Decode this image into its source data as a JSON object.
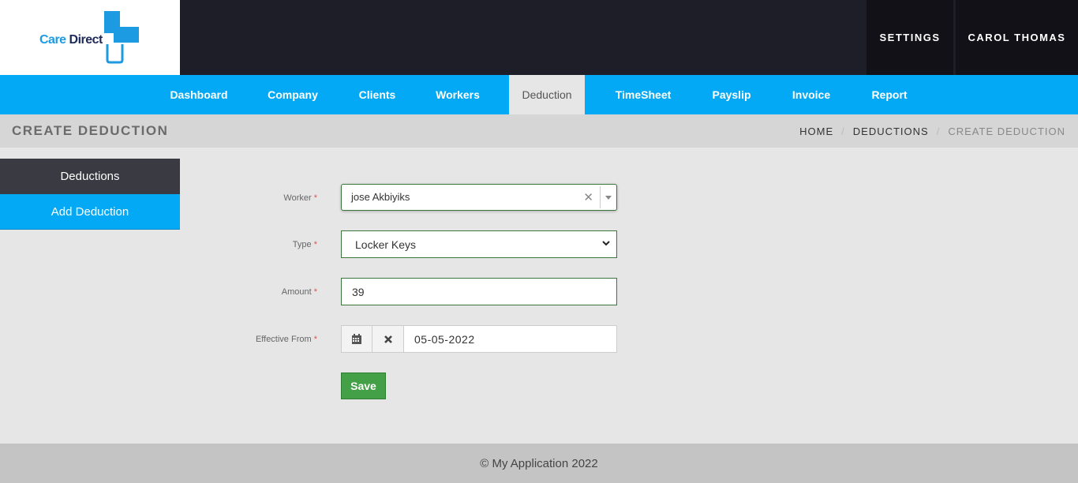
{
  "brand": {
    "logo_word1": "Care",
    "logo_word2": "Direct",
    "accent": "#03a9f4",
    "logo_dark": "#1e2a5a"
  },
  "header": {
    "settings_label": "SETTINGS",
    "user_label": "CAROL THOMAS"
  },
  "nav": {
    "items": [
      {
        "label": "Dashboard"
      },
      {
        "label": "Company"
      },
      {
        "label": "Clients"
      },
      {
        "label": "Workers"
      },
      {
        "label": "Deduction",
        "active": true
      },
      {
        "label": "TimeSheet"
      },
      {
        "label": "Payslip"
      },
      {
        "label": "Invoice"
      },
      {
        "label": "Report"
      }
    ]
  },
  "page": {
    "title": "CREATE DEDUCTION",
    "breadcrumb": [
      "HOME",
      "DEDUCTIONS",
      "CREATE DEDUCTION"
    ]
  },
  "sidebar": {
    "items": [
      {
        "label": "Deductions"
      },
      {
        "label": "Add Deduction",
        "active": true
      }
    ]
  },
  "form": {
    "worker": {
      "label": "Worker",
      "required": "*",
      "value": "jose Akbiyiks"
    },
    "type": {
      "label": "Type",
      "required": "*",
      "value": "Locker Keys"
    },
    "amount": {
      "label": "Amount",
      "required": "*",
      "value": "39"
    },
    "effective_from": {
      "label": "Effective From",
      "required": "*",
      "value": "05-05-2022"
    },
    "save_label": "Save"
  },
  "footer": {
    "text": "© My Application 2022"
  }
}
